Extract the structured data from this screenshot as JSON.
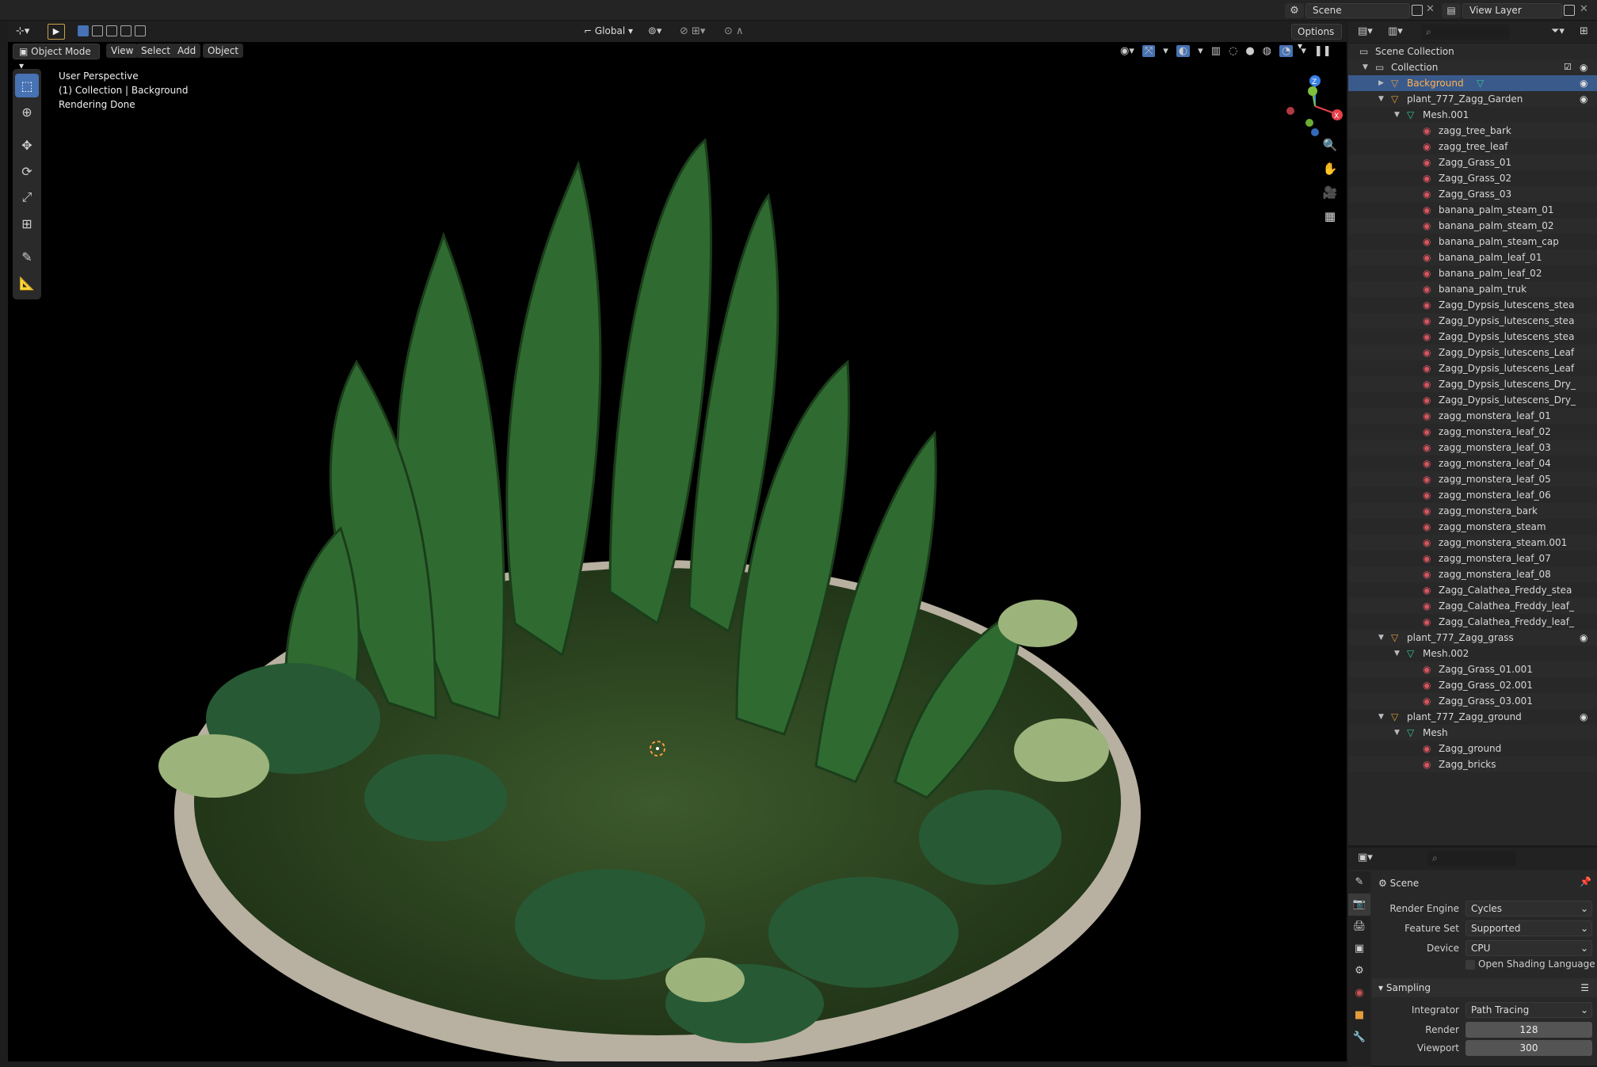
{
  "top": {
    "scene": "Scene",
    "view_layer": "View Layer"
  },
  "viewport": {
    "mode": "Object Mode",
    "menus": [
      "View",
      "Select",
      "Add",
      "Object"
    ],
    "orientation": "Global",
    "options": "Options",
    "info": [
      "User Perspective",
      "(1) Collection | Background",
      "Rendering Done"
    ],
    "gizmo": {
      "z": "Z",
      "x": "X",
      "y": "Y"
    }
  },
  "outliner": {
    "rows": [
      {
        "d": 0,
        "t": "Scene Collection",
        "ic": "collection"
      },
      {
        "d": 1,
        "t": "Collection",
        "ic": "collection",
        "tw": "v",
        "chk": true,
        "eye": true
      },
      {
        "d": 2,
        "t": "Background",
        "ic": "object",
        "tw": ">",
        "sel": true,
        "eye": true,
        "mesh": true
      },
      {
        "d": 2,
        "t": "plant_777_Zagg_Garden",
        "ic": "object",
        "tw": "v",
        "eye": true
      },
      {
        "d": 3,
        "t": "Mesh.001",
        "ic": "mesh",
        "tw": "v"
      },
      {
        "d": 4,
        "t": "zagg_tree_bark",
        "ic": "mat"
      },
      {
        "d": 4,
        "t": "zagg_tree_leaf",
        "ic": "mat"
      },
      {
        "d": 4,
        "t": "Zagg_Grass_01",
        "ic": "mat"
      },
      {
        "d": 4,
        "t": "Zagg_Grass_02",
        "ic": "mat"
      },
      {
        "d": 4,
        "t": "Zagg_Grass_03",
        "ic": "mat"
      },
      {
        "d": 4,
        "t": "banana_palm_steam_01",
        "ic": "mat"
      },
      {
        "d": 4,
        "t": "banana_palm_steam_02",
        "ic": "mat"
      },
      {
        "d": 4,
        "t": "banana_palm_steam_cap",
        "ic": "mat"
      },
      {
        "d": 4,
        "t": "banana_palm_leaf_01",
        "ic": "mat"
      },
      {
        "d": 4,
        "t": "banana_palm_leaf_02",
        "ic": "mat"
      },
      {
        "d": 4,
        "t": "banana_palm_truk",
        "ic": "mat"
      },
      {
        "d": 4,
        "t": "Zagg_Dypsis_lutescens_stea",
        "ic": "mat"
      },
      {
        "d": 4,
        "t": "Zagg_Dypsis_lutescens_stea",
        "ic": "mat"
      },
      {
        "d": 4,
        "t": "Zagg_Dypsis_lutescens_stea",
        "ic": "mat"
      },
      {
        "d": 4,
        "t": "Zagg_Dypsis_lutescens_Leaf",
        "ic": "mat"
      },
      {
        "d": 4,
        "t": "Zagg_Dypsis_lutescens_Leaf",
        "ic": "mat"
      },
      {
        "d": 4,
        "t": "Zagg_Dypsis_lutescens_Dry_",
        "ic": "mat"
      },
      {
        "d": 4,
        "t": "Zagg_Dypsis_lutescens_Dry_",
        "ic": "mat"
      },
      {
        "d": 4,
        "t": "zagg_monstera_leaf_01",
        "ic": "mat"
      },
      {
        "d": 4,
        "t": "zagg_monstera_leaf_02",
        "ic": "mat"
      },
      {
        "d": 4,
        "t": "zagg_monstera_leaf_03",
        "ic": "mat"
      },
      {
        "d": 4,
        "t": "zagg_monstera_leaf_04",
        "ic": "mat"
      },
      {
        "d": 4,
        "t": "zagg_monstera_leaf_05",
        "ic": "mat"
      },
      {
        "d": 4,
        "t": "zagg_monstera_leaf_06",
        "ic": "mat"
      },
      {
        "d": 4,
        "t": "zagg_monstera_bark",
        "ic": "mat"
      },
      {
        "d": 4,
        "t": "zagg_monstera_steam",
        "ic": "mat"
      },
      {
        "d": 4,
        "t": "zagg_monstera_steam.001",
        "ic": "mat"
      },
      {
        "d": 4,
        "t": "zagg_monstera_leaf_07",
        "ic": "mat"
      },
      {
        "d": 4,
        "t": "zagg_monstera_leaf_08",
        "ic": "mat"
      },
      {
        "d": 4,
        "t": "Zagg_Calathea_Freddy_stea",
        "ic": "mat"
      },
      {
        "d": 4,
        "t": "Zagg_Calathea_Freddy_leaf_",
        "ic": "mat"
      },
      {
        "d": 4,
        "t": "Zagg_Calathea_Freddy_leaf_",
        "ic": "mat"
      },
      {
        "d": 2,
        "t": "plant_777_Zagg_grass",
        "ic": "object",
        "tw": "v",
        "eye": true
      },
      {
        "d": 3,
        "t": "Mesh.002",
        "ic": "mesh",
        "tw": "v"
      },
      {
        "d": 4,
        "t": "Zagg_Grass_01.001",
        "ic": "mat"
      },
      {
        "d": 4,
        "t": "Zagg_Grass_02.001",
        "ic": "mat"
      },
      {
        "d": 4,
        "t": "Zagg_Grass_03.001",
        "ic": "mat"
      },
      {
        "d": 2,
        "t": "plant_777_Zagg_ground",
        "ic": "object",
        "tw": "v",
        "eye": true
      },
      {
        "d": 3,
        "t": "Mesh",
        "ic": "mesh",
        "tw": "v"
      },
      {
        "d": 4,
        "t": "Zagg_ground",
        "ic": "mat"
      },
      {
        "d": 4,
        "t": "Zagg_bricks",
        "ic": "mat"
      }
    ]
  },
  "properties": {
    "context": "Scene",
    "render_engine_label": "Render Engine",
    "render_engine": "Cycles",
    "feature_set_label": "Feature Set",
    "feature_set": "Supported",
    "device_label": "Device",
    "device": "CPU",
    "osl_label": "Open Shading Language",
    "sampling": "Sampling",
    "integrator_label": "Integrator",
    "integrator": "Path Tracing",
    "render_label": "Render",
    "render": "128",
    "viewport_label": "Viewport",
    "viewport": "300"
  },
  "colors": {
    "accent": "#4772b3",
    "selection_text": "#ffb24d",
    "material": "#d9555f",
    "mesh": "#35c49a",
    "object": "#e39c3c"
  }
}
